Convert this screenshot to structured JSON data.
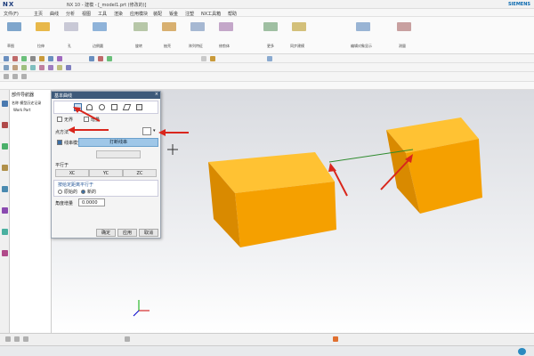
{
  "app": {
    "logo": "NX",
    "title": "NX 10 - 建模 - [_model1.prt (修改的)]",
    "brand": "SIEMENS"
  },
  "menu": [
    "文件(F)",
    "主页",
    "曲线",
    "分析",
    "视图",
    "工具",
    "渲染",
    "应用模块",
    "装配",
    "钣金",
    "注塑",
    "NX工具箱",
    "帮助"
  ],
  "ribbon": {
    "labels": [
      "草图",
      "拉伸",
      "孔",
      "边倒圆",
      "旋转",
      "抽壳",
      "阵列特征",
      "修剪体",
      "更多",
      "同步建模",
      "编辑对象显示",
      "测量"
    ]
  },
  "nav": {
    "header": "部件导航器",
    "item1": "名称 模型历史记录",
    "item2": "Work Part"
  },
  "dialog": {
    "title": "基本曲线",
    "tool_label": "点方法",
    "close": "×",
    "line_option": "线串模式",
    "break_button": "打断线串",
    "parallel_label": "平行于",
    "xc": "XC",
    "yc": "YC",
    "zc": "ZC",
    "sub_header": "按给定距离平行于",
    "opt_original": "原始的",
    "opt_new": "新的",
    "angle_label": "角度增量",
    "angle_value": "0.0000",
    "btn_ok": "确定",
    "btn_apply": "应用",
    "btn_cancel": "取消",
    "unbound_checkbox": "无界",
    "delta": "增量"
  },
  "colors": {
    "cube_front": "#f5a000",
    "cube_top": "#ffc233",
    "cube_side": "#d98a00",
    "arrow": "#d9261c",
    "line": "#2e8b2e"
  }
}
